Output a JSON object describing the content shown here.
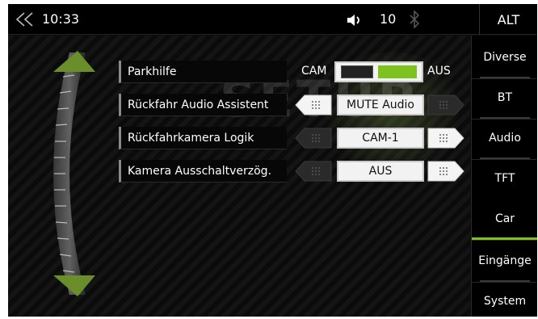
{
  "topbar": {
    "time": "10:33",
    "volume": "10",
    "alt_label": "ALT",
    "back_icon": "double-chevron-left-icon",
    "volume_icon": "speaker-icon",
    "bluetooth_icon": "bluetooth-icon"
  },
  "watermark": "SETUP",
  "settings": {
    "parkhilfe": {
      "label": "Parkhilfe",
      "left_option": "CAM",
      "right_option": "AUS",
      "toggle_position": "right"
    },
    "rows": [
      {
        "label": "Rückfahr Audio Assistent",
        "value": "MUTE Audio"
      },
      {
        "label": "Rückfahrkamera Logik",
        "value": "CAM-1"
      },
      {
        "label": "Kamera Ausschaltverzög.",
        "value": "AUS"
      }
    ]
  },
  "menu": {
    "items": [
      {
        "label": "Diverse"
      },
      {
        "label": "BT"
      },
      {
        "label": "Audio"
      },
      {
        "label": "TFT"
      },
      {
        "label": "Car"
      },
      {
        "label": "Eingänge"
      },
      {
        "label": "System"
      }
    ],
    "active": "Car"
  },
  "colors": {
    "accent": "#7dc21f",
    "background": "#0d0d0d"
  }
}
